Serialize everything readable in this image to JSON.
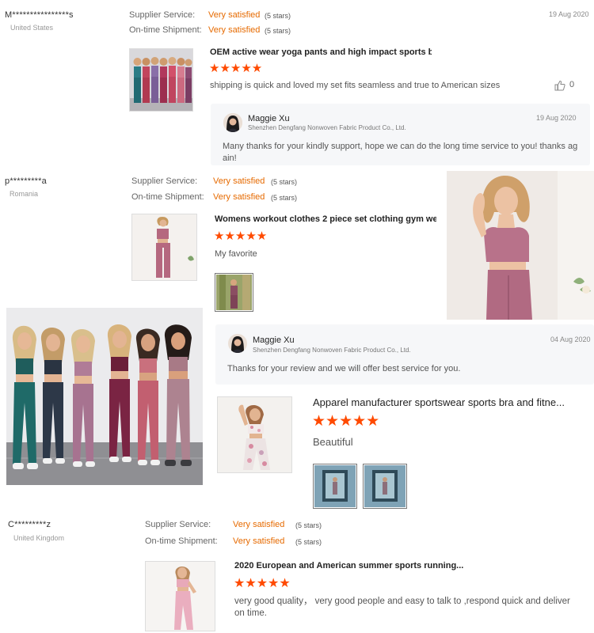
{
  "labels": {
    "supplier_service": "Supplier Service:",
    "ontime_shipment": "On-time Shipment:",
    "very_satisfied": "Very satisfied",
    "five_stars": "(5 stars)"
  },
  "review1": {
    "buyer": "M****************s",
    "country": "United States",
    "date": "19 Aug 2020",
    "title": "OEM active wear yoga pants and high impact sports b...",
    "stars": "★★★★★",
    "comment": "shipping is quick and loved my set fits seamless and true to American sizes",
    "likes": "0",
    "reply": {
      "name": "Maggie Xu",
      "company": "Shenzhen Dengfang Nonwoven Fabric Product Co., Ltd.",
      "date": "19 Aug 2020",
      "text": "Many thanks for your kindly support, hope we can do the long time service to you! thanks again!"
    }
  },
  "review2": {
    "buyer": "p*********a",
    "country": "Romania",
    "title": "Womens workout clothes 2 piece set clothing gym we...",
    "stars": "★★★★★",
    "comment": "My favorite",
    "reply": {
      "name": "Maggie Xu",
      "company": "Shenzhen Dengfang Nonwoven Fabric Product Co., Ltd.",
      "date": "04 Aug 2020",
      "text": "Thanks for your review and we will offer best service for you."
    }
  },
  "review3": {
    "title": "Apparel manufacturer sportswear sports bra and fitne...",
    "stars": "★★★★★",
    "comment": "Beautiful"
  },
  "review4": {
    "buyer": "C*********z",
    "country": "United Kingdom",
    "title": "2020 European and American summer sports running...",
    "stars": "★★★★★",
    "comment": "very good quality，  very good people and easy to talk to ,respond quick and deliver on time."
  },
  "icons": {
    "thumbs_up": "thumbs-up-icon",
    "star": "star-icon"
  },
  "colors": {
    "accent_orange": "#e66a00",
    "star_red": "#ff4a00",
    "reply_bg": "#f6f7f9"
  }
}
